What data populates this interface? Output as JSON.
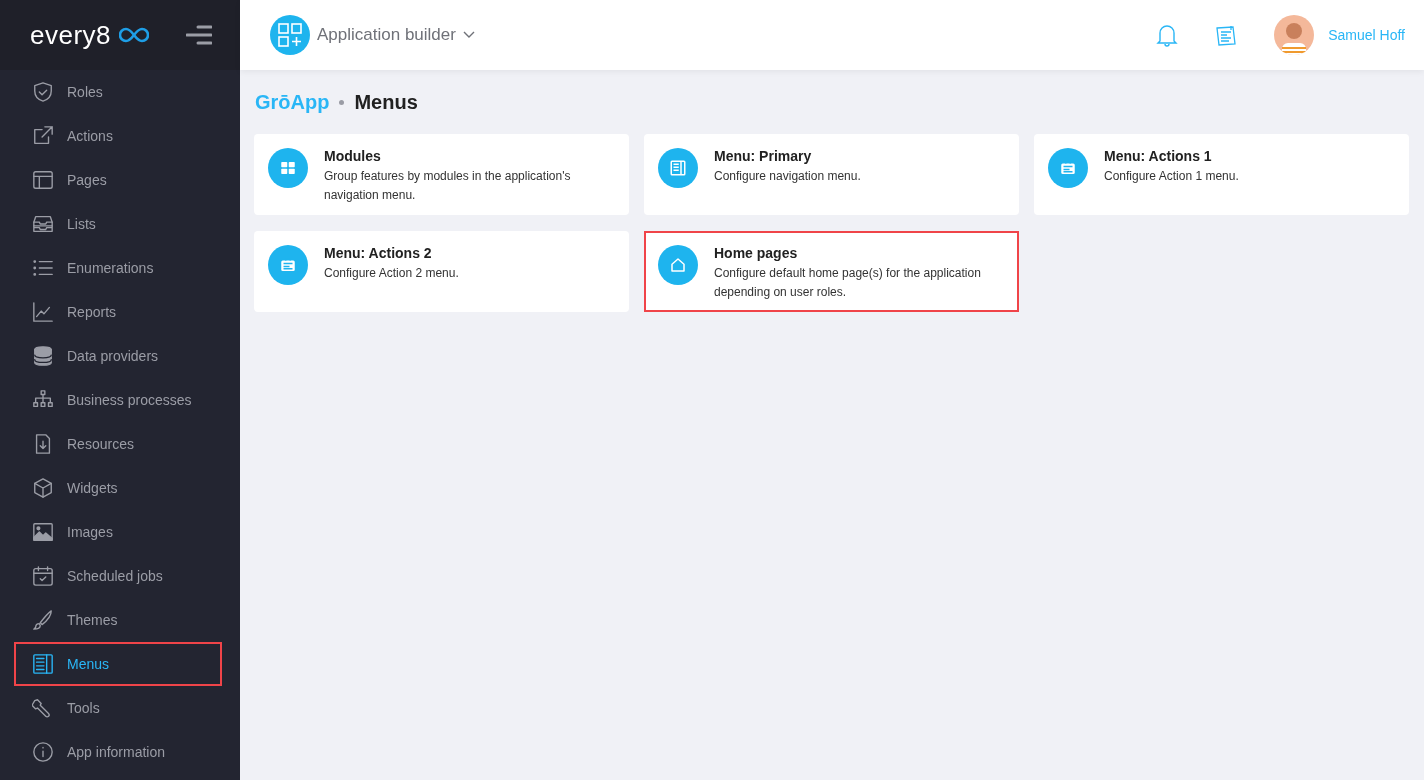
{
  "sidebar": {
    "logo": "every8",
    "items": [
      {
        "label": "Roles",
        "selected": false,
        "highlighted": false
      },
      {
        "label": "Actions",
        "selected": false,
        "highlighted": false
      },
      {
        "label": "Pages",
        "selected": false,
        "highlighted": false
      },
      {
        "label": "Lists",
        "selected": false,
        "highlighted": false
      },
      {
        "label": "Enumerations",
        "selected": false,
        "highlighted": false
      },
      {
        "label": "Reports",
        "selected": false,
        "highlighted": false
      },
      {
        "label": "Data providers",
        "selected": false,
        "highlighted": false
      },
      {
        "label": "Business processes",
        "selected": false,
        "highlighted": false
      },
      {
        "label": "Resources",
        "selected": false,
        "highlighted": false
      },
      {
        "label": "Widgets",
        "selected": false,
        "highlighted": false
      },
      {
        "label": "Images",
        "selected": false,
        "highlighted": false
      },
      {
        "label": "Scheduled jobs",
        "selected": false,
        "highlighted": false
      },
      {
        "label": "Themes",
        "selected": false,
        "highlighted": false
      },
      {
        "label": "Menus",
        "selected": true,
        "highlighted": true
      },
      {
        "label": "Tools",
        "selected": false,
        "highlighted": false
      },
      {
        "label": "App information",
        "selected": false,
        "highlighted": false
      }
    ]
  },
  "header": {
    "app_switcher": "Application builder",
    "user": "Samuel Hoff"
  },
  "breadcrumb": {
    "parent": "GrōApp",
    "current": "Menus"
  },
  "cards": [
    {
      "title": "Modules",
      "description": "Group features by modules in the application's navigation menu.",
      "highlighted": false
    },
    {
      "title": "Menu: Primary",
      "description": "Configure navigation menu.",
      "highlighted": false
    },
    {
      "title": "Menu: Actions 1",
      "description": "Configure Action 1 menu.",
      "highlighted": false
    },
    {
      "title": "Menu: Actions 2",
      "description": "Configure Action 2 menu.",
      "highlighted": false
    },
    {
      "title": "Home pages",
      "description": "Configure default home page(s) for the application depending on user roles.",
      "highlighted": true
    }
  ]
}
